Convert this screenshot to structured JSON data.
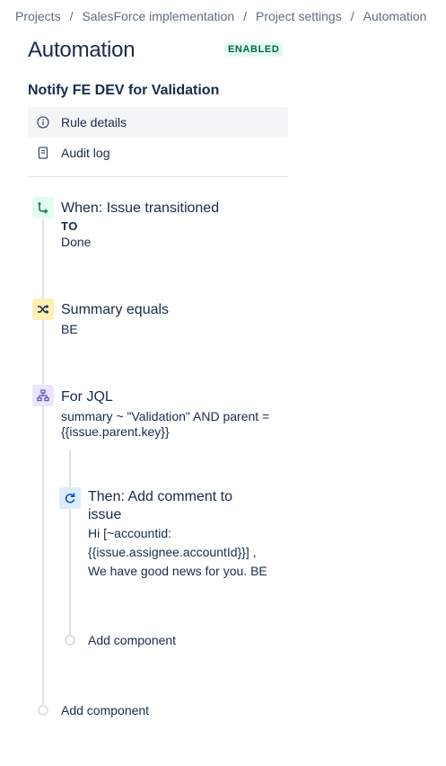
{
  "breadcrumbs": [
    "Projects",
    "SalesForce implementation",
    "Project settings",
    "Automation"
  ],
  "breadcrumb_separator": "/",
  "page_title": "Automation",
  "status_badge": "ENABLED",
  "rule_name": "Notify FE DEV for Validation",
  "menu": {
    "rule_details": "Rule details",
    "audit_log": "Audit log"
  },
  "components": {
    "trigger": {
      "title": "When: Issue transitioned",
      "line1": "TO",
      "line2": "Done",
      "icon": "transition-icon",
      "color": "#00875a"
    },
    "condition": {
      "title": "Summary equals",
      "line1": "BE",
      "icon": "shuffle-icon",
      "color": "#ff991f"
    },
    "branch": {
      "title": "For JQL",
      "line1": "summary ~ \"Validation\" AND parent =",
      "line2": "{{issue.parent.key}}",
      "icon": "hierarchy-icon",
      "color": "#6554c0"
    },
    "action": {
      "title_line1": "Then: Add comment to",
      "title_line2": "issue",
      "line1": "Hi [~accountid:",
      "line2": "{{issue.assignee.accountId}}] ,",
      "line3": "We have good news for you. BE",
      "icon": "refresh-icon",
      "color": "#0052cc"
    }
  },
  "add_component_inner": "Add component",
  "add_component_outer": "Add component"
}
